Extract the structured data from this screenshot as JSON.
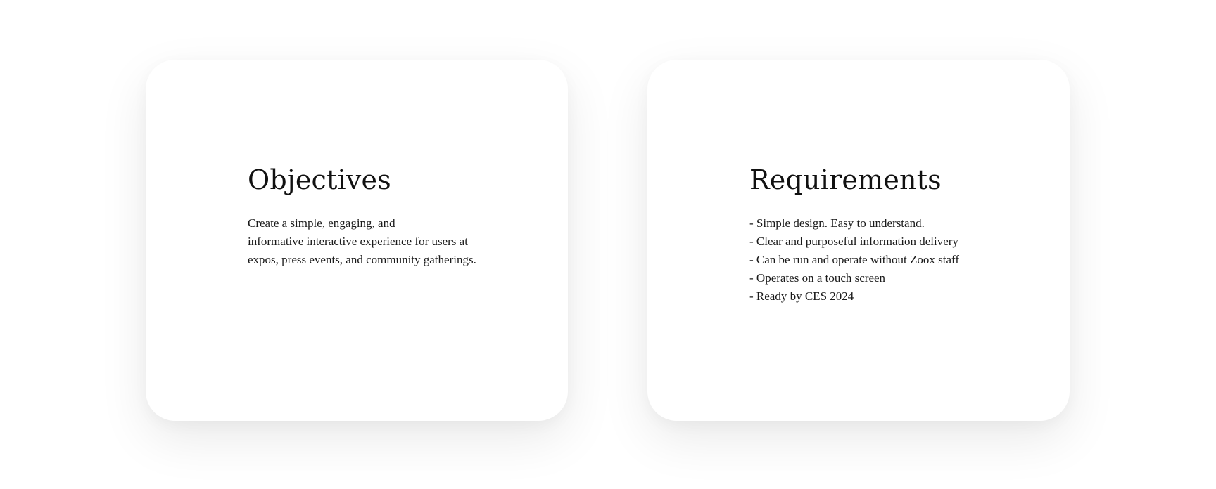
{
  "objectives": {
    "title": "Objectives",
    "lines": [
      "Create a simple, engaging, and",
      "informative interactive experience for users at",
      "expos, press events, and community gatherings."
    ]
  },
  "requirements": {
    "title": "Requirements",
    "items": [
      "- Simple design. Easy to understand.",
      "- Clear and purposeful information delivery",
      "- Can be run and operate without Zoox staff",
      "- Operates on a touch screen",
      "- Ready by CES 2024"
    ]
  }
}
